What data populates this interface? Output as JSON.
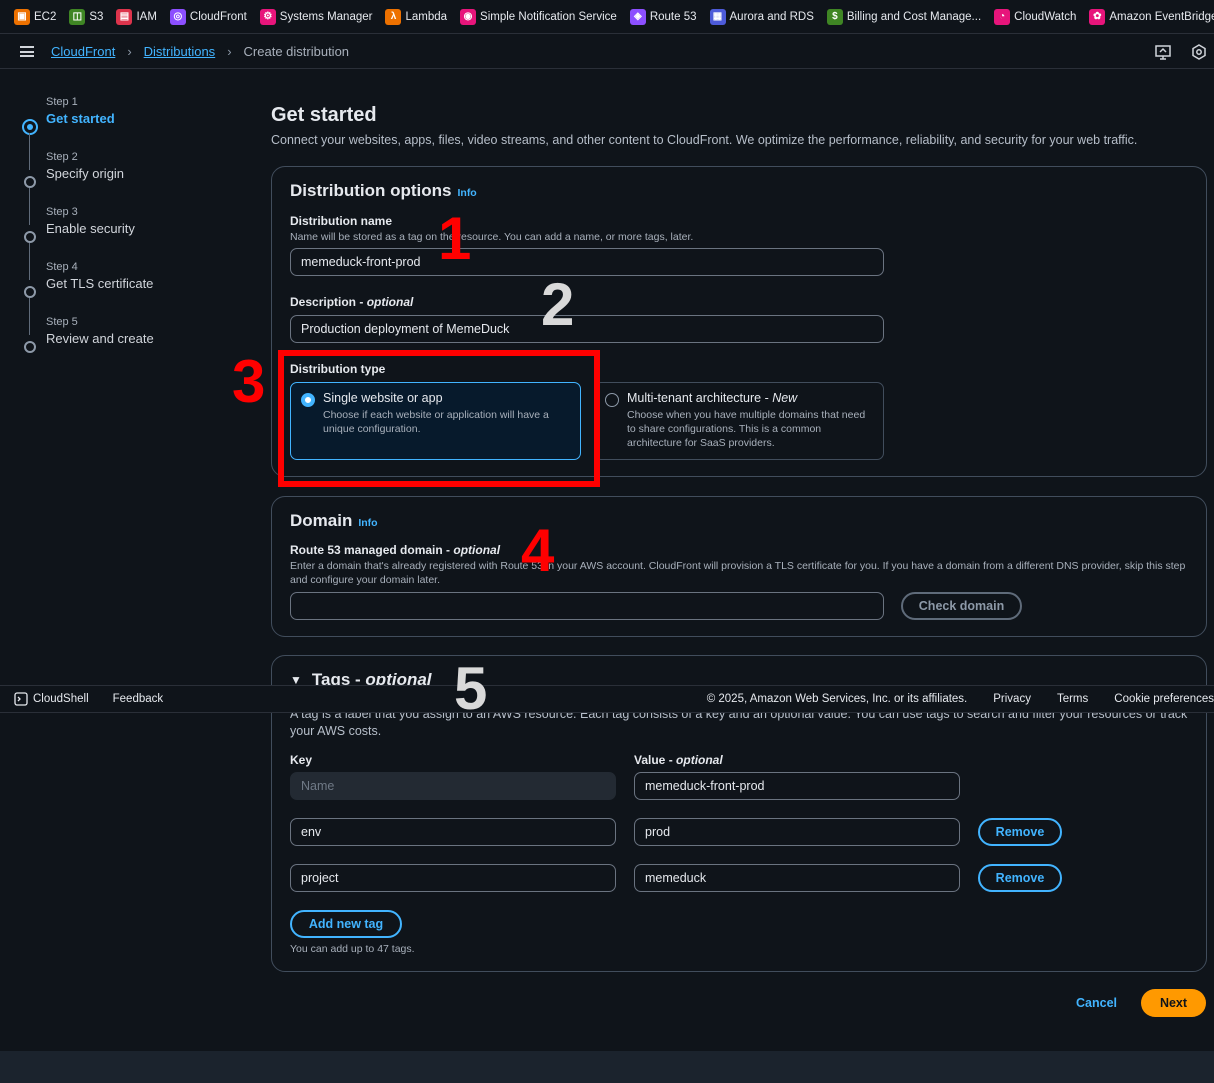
{
  "favorites": [
    {
      "label": "EC2",
      "icon": "ec2-icon",
      "color": "#ed7100"
    },
    {
      "label": "S3",
      "icon": "s3-icon",
      "color": "#3f8624"
    },
    {
      "label": "IAM",
      "icon": "iam-icon",
      "color": "#dd344c"
    },
    {
      "label": "CloudFront",
      "icon": "cloudfront-icon",
      "color": "#8c4fff"
    },
    {
      "label": "Systems Manager",
      "icon": "systems-manager-icon",
      "color": "#e7157b"
    },
    {
      "label": "Lambda",
      "icon": "lambda-icon",
      "color": "#ed7100"
    },
    {
      "label": "Simple Notification Service",
      "icon": "sns-icon",
      "color": "#e7157b"
    },
    {
      "label": "Route 53",
      "icon": "route53-icon",
      "color": "#8c4fff"
    },
    {
      "label": "Aurora and RDS",
      "icon": "rds-icon",
      "color": "#4d5bd9"
    },
    {
      "label": "Billing and Cost Manage...",
      "icon": "billing-icon",
      "color": "#3f8624"
    },
    {
      "label": "CloudWatch",
      "icon": "cloudwatch-icon",
      "color": "#e7157b"
    },
    {
      "label": "Amazon EventBridge",
      "icon": "eventbridge-icon",
      "color": "#e7157b"
    }
  ],
  "breadcrumb": {
    "root": "CloudFront",
    "section": "Distributions",
    "current": "Create distribution"
  },
  "steps": [
    {
      "num": "Step 1",
      "label": "Get started"
    },
    {
      "num": "Step 2",
      "label": "Specify origin"
    },
    {
      "num": "Step 3",
      "label": "Enable security"
    },
    {
      "num": "Step 4",
      "label": "Get TLS certificate"
    },
    {
      "num": "Step 5",
      "label": "Review and create"
    }
  ],
  "page": {
    "title": "Get started",
    "lead": "Connect your websites, apps, files, video streams, and other content to CloudFront. We optimize the performance, reliability, and security for your web traffic."
  },
  "options": {
    "title": "Distribution options",
    "info": "Info",
    "name_label": "Distribution name",
    "name_hint": "Name will be stored as a tag on the resource. You can add a name, or more tags, later.",
    "name_value": "memeduck-front-prod",
    "desc_label": "Description",
    "desc_optional": "optional",
    "desc_value": "Production deployment of MemeDuck",
    "type_label": "Distribution type",
    "single_title": "Single website or app",
    "single_desc": "Choose if each website or application will have a unique configuration.",
    "multi_title": "Multi-tenant architecture",
    "multi_new": "New",
    "multi_desc": "Choose when you have multiple domains that need to share configurations. This is a common architecture for SaaS providers."
  },
  "domain": {
    "title": "Domain",
    "info": "Info",
    "label": "Route 53 managed domain",
    "optional": "optional",
    "hint": "Enter a domain that's already registered with Route 53 in your AWS account. CloudFront will provision a TLS certificate for you. If you have a domain from a different DNS provider, skip this step and configure your domain later.",
    "value": "",
    "check_button": "Check domain"
  },
  "tags": {
    "title": "Tags",
    "optional": "optional",
    "hint": "A tag is a label that you assign to an AWS resource. Each tag consists of a key and an optional value. You can use tags to search and filter your resources or track your AWS costs.",
    "key_header": "Key",
    "value_header": "Value",
    "value_optional": "optional",
    "rows": [
      {
        "key": "",
        "key_placeholder": "Name",
        "value": "memeduck-front-prod"
      },
      {
        "key": "env",
        "value": "prod",
        "remove": "Remove"
      },
      {
        "key": "project",
        "value": "memeduck",
        "remove": "Remove"
      }
    ],
    "add_button": "Add new tag",
    "limit_note": "You can add up to 47 tags."
  },
  "actions": {
    "cancel": "Cancel",
    "next": "Next"
  },
  "footer": {
    "cloudshell": "CloudShell",
    "feedback": "Feedback",
    "copyright": "© 2025, Amazon Web Services, Inc. or its affiliates.",
    "privacy": "Privacy",
    "terms": "Terms",
    "cookies": "Cookie preferences"
  },
  "annotations": [
    "1",
    "2",
    "3",
    "4",
    "5"
  ],
  "colors": {
    "accent": "#42b4ff",
    "primary_button": "#ff9900",
    "annotation_red": "#ff0000",
    "background": "#0f141a"
  }
}
